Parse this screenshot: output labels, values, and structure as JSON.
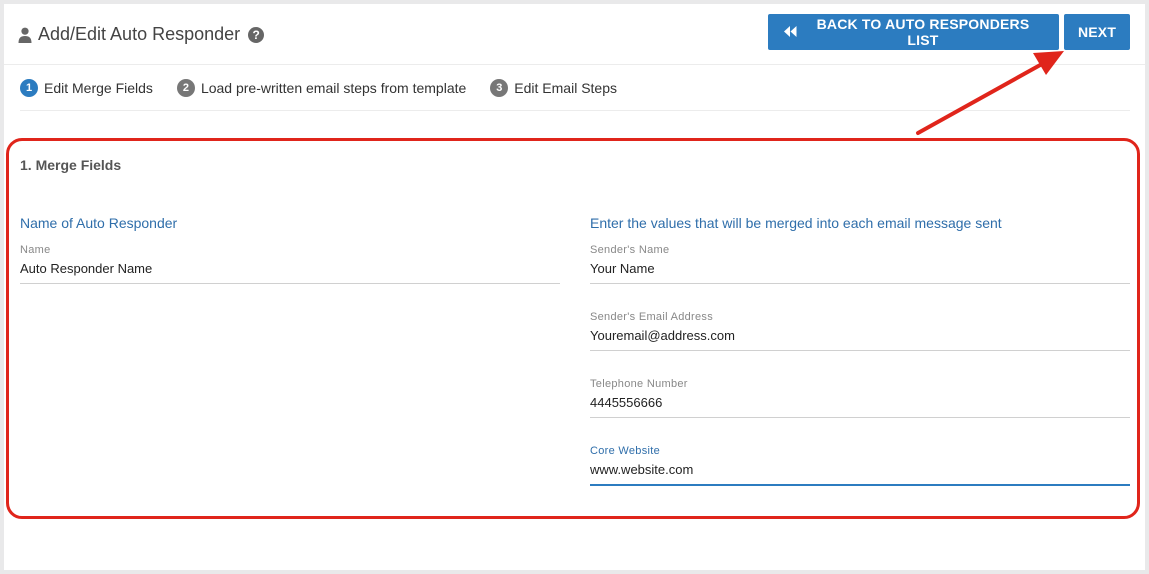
{
  "header": {
    "title": "Add/Edit Auto Responder",
    "user_icon": "user-icon",
    "help_icon": "help-icon",
    "help_glyph": "?",
    "back_button_label": "BACK TO AUTO RESPONDERS LIST",
    "back_icon": "double-chevron-left-icon",
    "next_button_label": "NEXT"
  },
  "steps": [
    {
      "number": "1",
      "label": "Edit Merge Fields",
      "active": true
    },
    {
      "number": "2",
      "label": "Load pre-written email steps from template",
      "active": false
    },
    {
      "number": "3",
      "label": "Edit Email Steps",
      "active": false
    }
  ],
  "section": {
    "title": "1. Merge Fields",
    "left_heading": "Name of Auto Responder",
    "right_heading": "Enter the values that will be merged into each email message sent",
    "name_field": {
      "label": "Name",
      "value": "Auto Responder Name"
    },
    "sender_name": {
      "label": "Sender's Name",
      "value": "Your Name"
    },
    "sender_email": {
      "label": "Sender's Email Address",
      "value": "Youremail@address.com"
    },
    "telephone": {
      "label": "Telephone Number",
      "value": "4445556666"
    },
    "website": {
      "label": "Core Website",
      "value": "www.website.com"
    }
  },
  "colors": {
    "primary": "#2c7cc0",
    "heading_blue": "#2f6eaa",
    "annotation_red": "#e0251b"
  }
}
